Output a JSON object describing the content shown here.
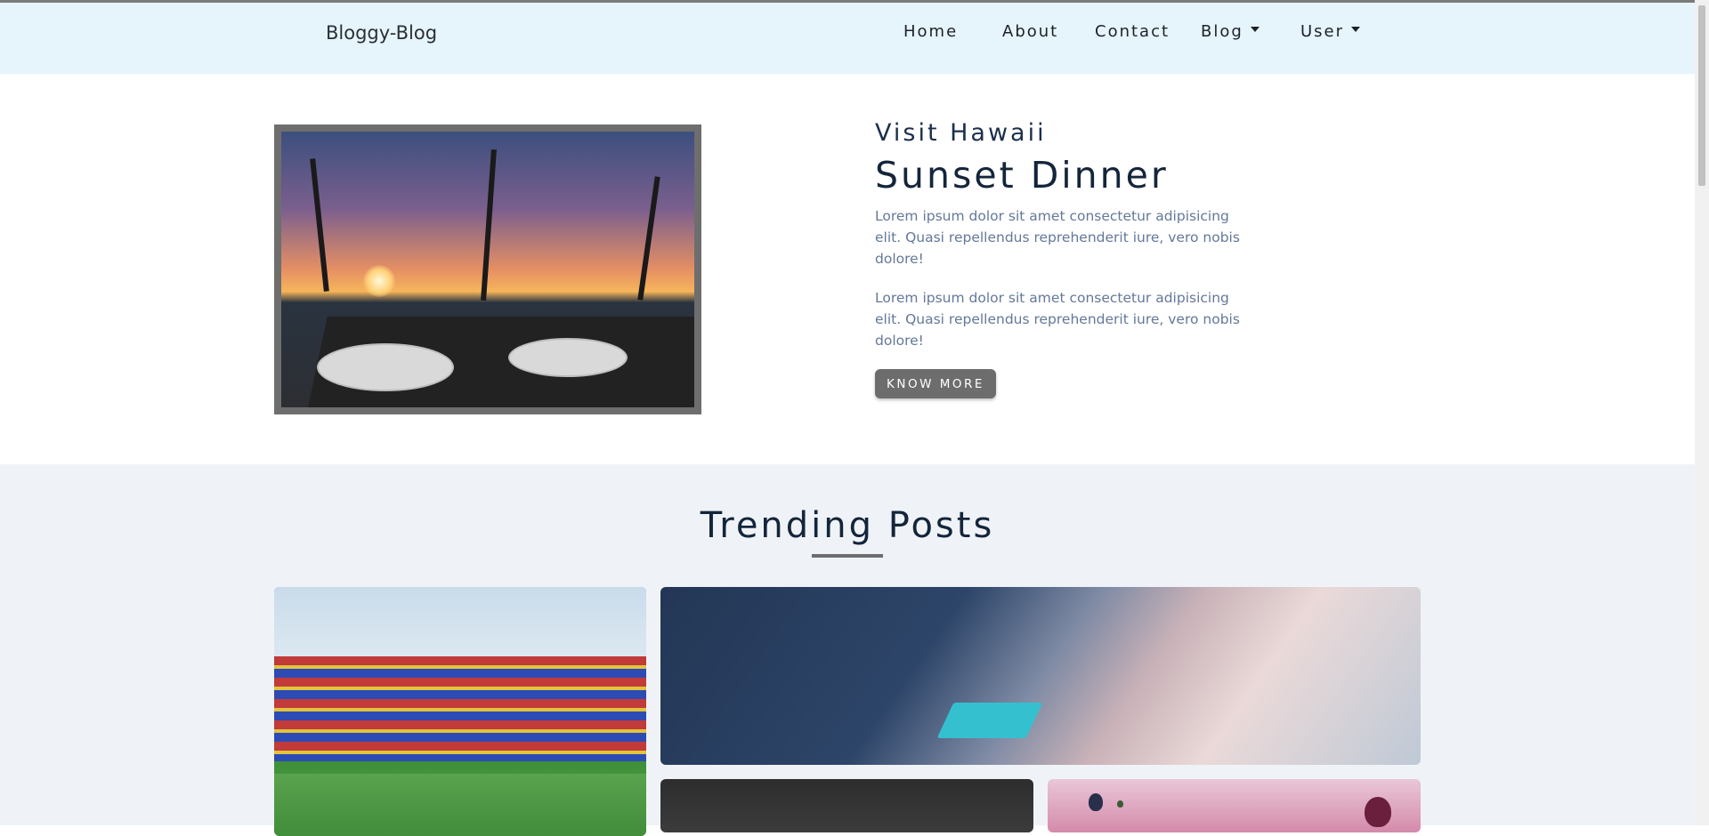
{
  "navbar": {
    "brand": "Bloggy-Blog",
    "items": [
      {
        "label": "Home"
      },
      {
        "label": "About"
      },
      {
        "label": "Contact"
      },
      {
        "label": "Blog"
      },
      {
        "label": "User"
      }
    ],
    "icons": {
      "blog_dropdown": "caret-down-icon",
      "user_dropdown": "caret-down-icon"
    }
  },
  "hero": {
    "subtitle": "Visit Hawaii",
    "title": "Sunset Dinner",
    "paragraphs": [
      "Lorem ipsum dolor sit amet consectetur adipisicing elit. Quasi repellendus reprehenderit iure, vero nobis dolore!",
      "Lorem ipsum dolor sit amet consectetur adipisicing elit. Quasi repellendus reprehenderit iure, vero nobis dolore!"
    ],
    "button_label": "KNOW MORE"
  },
  "trending": {
    "title": "Trending Posts"
  },
  "colors": {
    "navbar_bg": "#e6f4fc",
    "text_dark": "#14253b",
    "text_muted": "#64789a",
    "button_bg": "#6d6d6d",
    "section_bg": "#eff3f7"
  }
}
